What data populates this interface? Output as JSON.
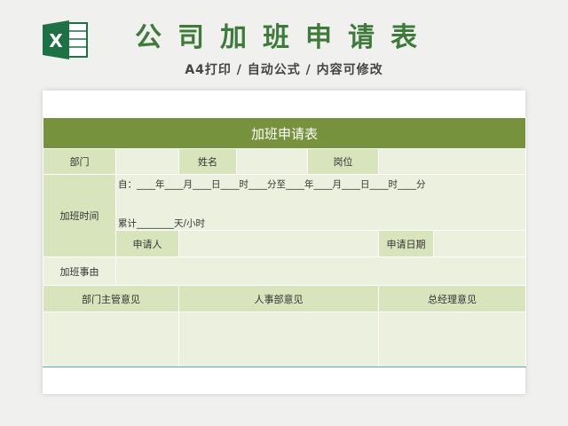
{
  "header": {
    "title": "公司加班申请表",
    "subtitle": "A4打印 / 自动公式 / 内容可修改"
  },
  "logo": {
    "icon": "excel-icon",
    "letter": "X",
    "color": "#1e7145"
  },
  "form": {
    "title": "加班申请表",
    "row1": {
      "department_label": "部门",
      "name_label": "姓名",
      "position_label": "岗位"
    },
    "overtime_time_label": "加班时间",
    "time_line": "自：____年____月____日____时____分至____年____月____日____时____分",
    "total_line": "累计________天/小时",
    "applicant_label": "申请人",
    "apply_date_label": "申请日期",
    "reason_label": "加班事由",
    "opinions": {
      "dept_manager": "部门主管意见",
      "hr": "人事部意见",
      "gm": "总经理意见"
    }
  },
  "colors": {
    "header_green": "#76923c",
    "label_green": "#d8e4bc",
    "cell_light": "#ebf1de",
    "title_green": "#3f7a3a"
  }
}
